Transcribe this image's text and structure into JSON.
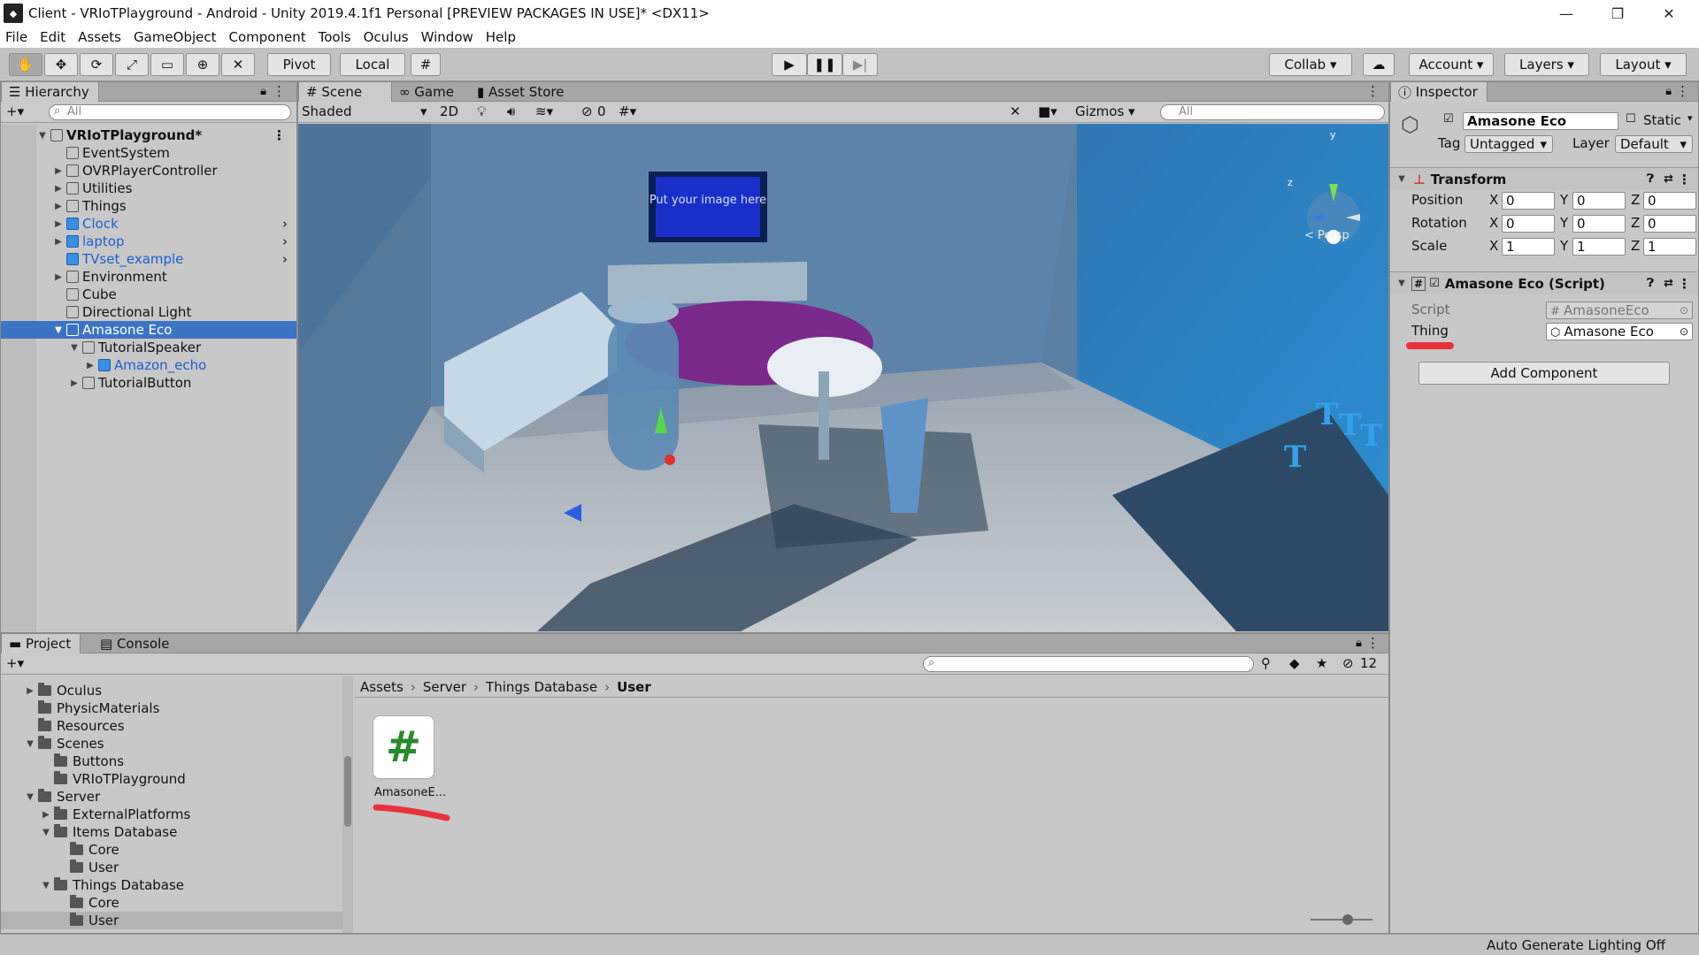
{
  "window": {
    "title": "Client - VRIoTPlayground - Android - Unity 2019.4.1f1 Personal [PREVIEW PACKAGES IN USE]* <DX11>",
    "icon": "unity-icon"
  },
  "menu": [
    "File",
    "Edit",
    "Assets",
    "GameObject",
    "Component",
    "Tools",
    "Oculus",
    "Window",
    "Help"
  ],
  "toolbar": {
    "pivot": "Pivot",
    "local": "Local",
    "collab": "Collab",
    "account": "Account",
    "layers": "Layers",
    "layout": "Layout"
  },
  "hierarchy": {
    "tab": "Hierarchy",
    "search_placeholder": "All",
    "scene": "VRIoTPlayground*",
    "items": [
      {
        "label": "EventSystem",
        "depth": 1,
        "arrow": "",
        "prefab": false
      },
      {
        "label": "OVRPlayerController",
        "depth": 1,
        "arrow": "▶",
        "prefab": false
      },
      {
        "label": "Utilities",
        "depth": 1,
        "arrow": "▶",
        "prefab": false
      },
      {
        "label": "Things",
        "depth": 1,
        "arrow": "▶",
        "prefab": false
      },
      {
        "label": "Clock",
        "depth": 1,
        "arrow": "▶",
        "prefab": true
      },
      {
        "label": "laptop",
        "depth": 1,
        "arrow": "▶",
        "prefab": true
      },
      {
        "label": "TVset_example",
        "depth": 1,
        "arrow": "",
        "prefab": true
      },
      {
        "label": "Environment",
        "depth": 1,
        "arrow": "▶",
        "prefab": false
      },
      {
        "label": "Cube",
        "depth": 1,
        "arrow": "",
        "prefab": false
      },
      {
        "label": "Directional Light",
        "depth": 1,
        "arrow": "",
        "prefab": false
      },
      {
        "label": "Amasone Eco",
        "depth": 1,
        "arrow": "▼",
        "prefab": false,
        "selected": true
      },
      {
        "label": "TutorialSpeaker",
        "depth": 2,
        "arrow": "▼",
        "prefab": false
      },
      {
        "label": "Amazon_echo",
        "depth": 3,
        "arrow": "▶",
        "prefab": true
      },
      {
        "label": "TutorialButton",
        "depth": 2,
        "arrow": "▶",
        "prefab": false
      }
    ]
  },
  "scene_view": {
    "tabs": [
      "Scene",
      "Game",
      "Asset Store"
    ],
    "shading": "Shaded",
    "mode_2d": "2D",
    "hidden_count": "0",
    "gizmos": "Gizmos",
    "search_placeholder": "All",
    "persp": "Persp",
    "tv_text": "Put your image here"
  },
  "inspector": {
    "tab": "Inspector",
    "object_name": "Amasone Eco",
    "static_label": "Static",
    "tag_label": "Tag",
    "tag_value": "Untagged",
    "layer_label": "Layer",
    "layer_value": "Default",
    "transform": {
      "title": "Transform",
      "position_label": "Position",
      "rotation_label": "Rotation",
      "scale_label": "Scale",
      "position": [
        "0",
        "0",
        "0"
      ],
      "rotation": [
        "0",
        "0",
        "0"
      ],
      "scale": [
        "1",
        "1",
        "1"
      ]
    },
    "script_component": {
      "title": "Amasone Eco (Script)",
      "script_label": "Script",
      "script_value": "AmasoneEco",
      "thing_label": "Thing",
      "thing_value": "Amasone Eco"
    },
    "add_component": "Add Component"
  },
  "project": {
    "tabs": [
      "Project",
      "Console"
    ],
    "hidden_count": "12",
    "tree": [
      {
        "label": "Oculus",
        "depth": 1,
        "arrow": "▶"
      },
      {
        "label": "PhysicMaterials",
        "depth": 1,
        "arrow": ""
      },
      {
        "label": "Resources",
        "depth": 1,
        "arrow": ""
      },
      {
        "label": "Scenes",
        "depth": 1,
        "arrow": "▼"
      },
      {
        "label": "Buttons",
        "depth": 2,
        "arrow": ""
      },
      {
        "label": "VRIoTPlayground",
        "depth": 2,
        "arrow": ""
      },
      {
        "label": "Server",
        "depth": 1,
        "arrow": "▼"
      },
      {
        "label": "ExternalPlatforms",
        "depth": 2,
        "arrow": "▶"
      },
      {
        "label": "Items Database",
        "depth": 2,
        "arrow": "▼"
      },
      {
        "label": "Core",
        "depth": 3,
        "arrow": ""
      },
      {
        "label": "User",
        "depth": 3,
        "arrow": ""
      },
      {
        "label": "Things Database",
        "depth": 2,
        "arrow": "▼"
      },
      {
        "label": "Core",
        "depth": 3,
        "arrow": ""
      },
      {
        "label": "User",
        "depth": 3,
        "arrow": "",
        "selected": true
      }
    ],
    "breadcrumb": [
      "Assets",
      "Server",
      "Things Database",
      "User"
    ],
    "asset": {
      "label": "AmasoneE...",
      "glyph": "#"
    }
  },
  "status": {
    "text": "Auto Generate Lighting Off"
  }
}
